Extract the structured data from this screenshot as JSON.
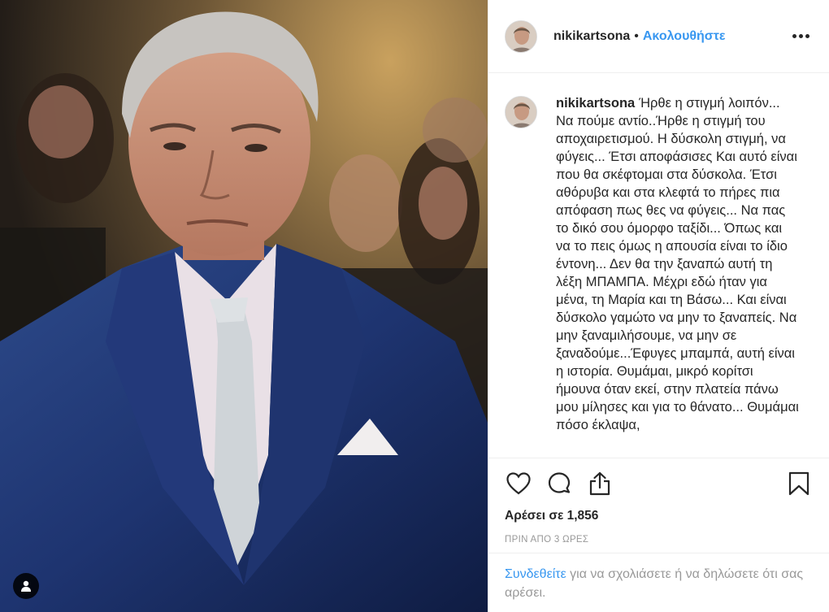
{
  "post": {
    "username": "nikikartsona",
    "dot": "•",
    "follow_label": "Ακολουθήστε",
    "caption_text": "Ήρθε η στιγμή λοιπόν... Να πούμε αντίο..Ήρθε η στιγμή του αποχαιρετισμού. Η δύσκολη στιγμή, να φύγεις... Έτσι αποφάσισες Και αυτό είναι που θα σκέφτομαι στα δύσκολα. Έτσι αθόρυβα και στα κλεφτά το πήρες πια απόφαση πως θες να φύγεις... Να πας το δικό σου όμορφο ταξίδι... Όπως και να το πεις όμως η απουσία είναι το ίδιο έντονη... Δεν θα την ξαναπώ αυτή τη λέξη ΜΠΑΜΠΑ. Μέχρι εδώ ήταν για μένα, τη Μαρία και τη Βάσω... Και είναι δύσκολο γαμώτο να μην το ξαναπείς. Να μην ξαναμιλήσουμε, να μην σε ξαναδούμε...Έφυγες μπαμπά, αυτή είναι η ιστορία. Θυμάμαι, μικρό κορίτσι ήμουνα όταν εκεί, στην πλατεία πάνω μου μίλησες και για το θάνατο... Θυμάμαι πόσο έκλαψα,",
    "likes": "Αρέσει σε 1,856",
    "time": "ΠΡΙΝ ΑΠΟ 3 ΩΡΕΣ"
  },
  "login": {
    "link_label": "Συνδεθείτε",
    "rest": " για να σχολιάσετε ή να δηλώσετε ότι σας αρέσει."
  },
  "icons": [
    "heart-icon",
    "comment-icon",
    "share-icon",
    "bookmark-icon",
    "more-icon",
    "user-tag-icon"
  ],
  "colors": {
    "accent": "#3897f0",
    "muted": "#999999",
    "text": "#262626",
    "border": "#efefef"
  }
}
